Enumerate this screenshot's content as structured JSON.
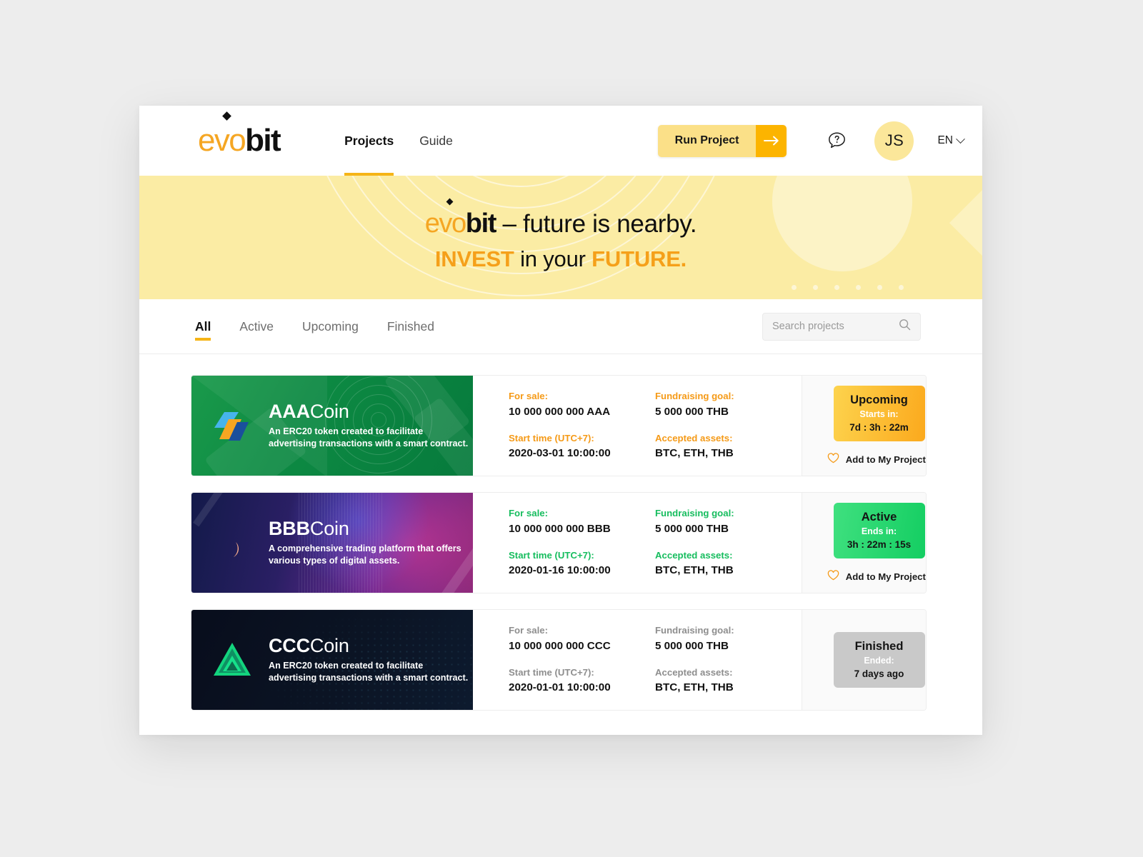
{
  "header": {
    "logo": {
      "part1": "evo",
      "part2": "bit"
    },
    "nav": [
      {
        "label": "Projects",
        "active": true
      },
      {
        "label": "Guide",
        "active": false
      }
    ],
    "run_project_label": "Run Project",
    "run_project_icon": "arrow-right-icon",
    "help_icon": "help-chat-icon",
    "avatar_initials": "JS",
    "language": "EN",
    "language_chevron": "chevron-down-icon"
  },
  "hero": {
    "logo_part1": "evo",
    "logo_part2": "bit",
    "line1_rest": " – future is nearby.",
    "line2_pre": "INVEST",
    "line2_mid": " in your ",
    "line2_post": "FUTURE.",
    "bg_color": "#fbeca4",
    "accent_color": "#f5a01a"
  },
  "filters": {
    "tabs": [
      {
        "label": "All",
        "active": true
      },
      {
        "label": "Active",
        "active": false
      },
      {
        "label": "Upcoming",
        "active": false
      },
      {
        "label": "Finished",
        "active": false
      }
    ],
    "search": {
      "placeholder": "Search projects",
      "value": "",
      "icon": "search-icon"
    }
  },
  "labels": {
    "for_sale": "For sale:",
    "fundraising_goal": "Fundraising goal:",
    "start_time": "Start time (UTC+7):",
    "accepted_assets": "Accepted assets:",
    "add_to_my_projects": "Add to My Projects",
    "heart_icon": "heart-outline-icon"
  },
  "projects": [
    {
      "name_bold": "AAA",
      "name_rest": "Coin",
      "description": "An ERC20 token created to facilitate advertising transactions with a smart contract.",
      "for_sale": "10 000 000 000 AAA",
      "fundraising_goal": "5 000 000 THB",
      "start_time": "2020-03-01 10:00:00",
      "accepted_assets": "BTC, ETH, THB",
      "label_color": "#f59a17",
      "status": {
        "title": "Upcoming",
        "sub": "Starts in:",
        "time": "7d : 3h : 22m"
      },
      "show_favorite": true
    },
    {
      "name_bold": "BBB",
      "name_rest": "Coin",
      "description": "A comprehensive trading platform that offers various types of digital assets.",
      "for_sale": "10 000 000 000 BBB",
      "fundraising_goal": "5 000 000 THB",
      "start_time": "2020-01-16 10:00:00",
      "accepted_assets": "BTC, ETH, THB",
      "label_color": "#16bd5e",
      "status": {
        "title": "Active",
        "sub": "Ends in:",
        "time": "3h : 22m : 15s"
      },
      "show_favorite": true
    },
    {
      "name_bold": "CCC",
      "name_rest": "Coin",
      "description": "An ERC20 token created to facilitate advertising transactions with a smart contract.",
      "for_sale": "10 000 000 000 CCC",
      "fundraising_goal": "5 000 000 THB",
      "start_time": "2020-01-01 10:00:00",
      "accepted_assets": "BTC, ETH, THB",
      "label_color": "#8e8e8e",
      "status": {
        "title": "Finished",
        "sub": "Ended:",
        "time": "7 days ago"
      },
      "show_favorite": false
    }
  ]
}
